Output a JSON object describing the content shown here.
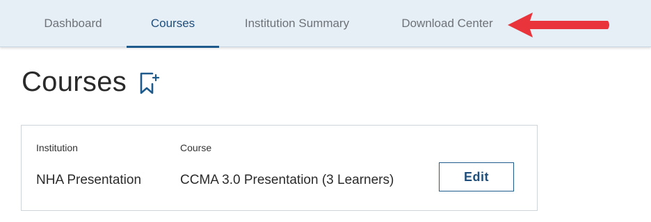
{
  "nav": {
    "tabs": [
      {
        "label": "Dashboard",
        "active": false
      },
      {
        "label": "Courses",
        "active": true
      },
      {
        "label": "Institution Summary",
        "active": false
      },
      {
        "label": "Download Center",
        "active": false
      }
    ]
  },
  "page": {
    "title": "Courses"
  },
  "card": {
    "columns": [
      "Institution",
      "Course"
    ],
    "row": {
      "institution": "NHA Presentation",
      "course": "CCMA 3.0 Presentation (3 Learners)"
    },
    "edit_label": "Edit"
  },
  "colors": {
    "accent": "#1f5a8c",
    "tabbar_bg": "#e6eef6",
    "arrow": "#e8343a"
  },
  "icons": {
    "bookmark": "bookmark-plus-icon",
    "annotation": "red-arrow-icon"
  }
}
